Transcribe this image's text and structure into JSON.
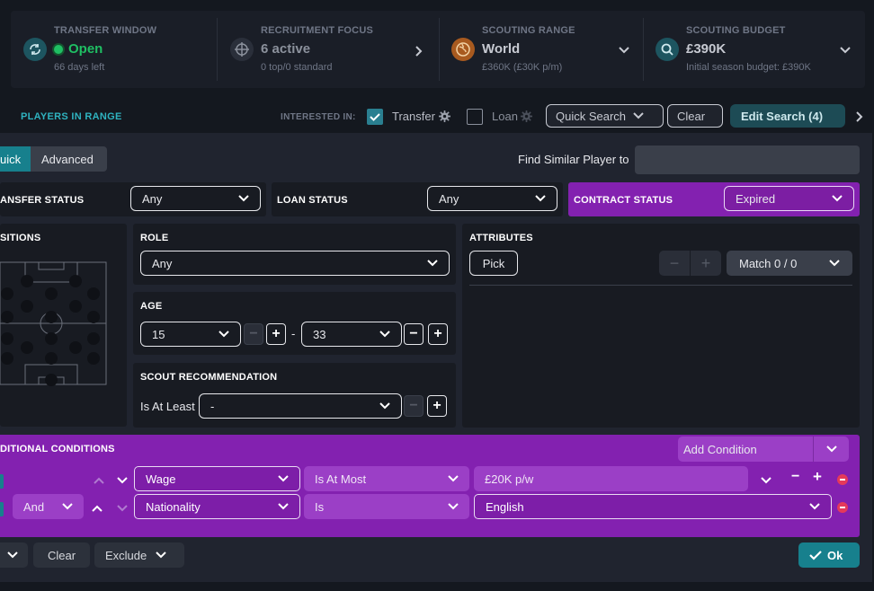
{
  "summary": {
    "transfer_window": {
      "label": "TRANSFER WINDOW",
      "value": "Open",
      "sub": "66 days left"
    },
    "recruitment_focus": {
      "label": "RECRUITMENT FOCUS",
      "value": "6 active",
      "sub": "0 top/0 standard"
    },
    "scouting_range": {
      "label": "SCOUTING RANGE",
      "value": "World",
      "sub": "£360K (£30K p/m)"
    },
    "scouting_budget": {
      "label": "SCOUTING BUDGET",
      "value": "£390K",
      "sub": "Initial season budget: £390K"
    }
  },
  "toolbar": {
    "players_in_range": "PLAYERS IN RANGE",
    "interested_in": "INTERESTED IN:",
    "transfer_label": "Transfer",
    "transfer_checked": true,
    "loan_label": "Loan",
    "loan_checked": false,
    "quick_search": "Quick Search",
    "clear": "Clear",
    "edit_search": "Edit Search (4)"
  },
  "tabs": {
    "quick": "uick",
    "advanced": "Advanced"
  },
  "find_similar": {
    "label": "Find Similar Player to",
    "value": ""
  },
  "status": {
    "transfer_label": "ANSFER STATUS",
    "transfer_value": "Any",
    "loan_label": "LOAN STATUS",
    "loan_value": "Any",
    "contract_label": "CONTRACT STATUS",
    "contract_value": "Expired"
  },
  "positions": {
    "label": "SITIONS"
  },
  "role": {
    "label": "ROLE",
    "value": "Any"
  },
  "age": {
    "label": "AGE",
    "min": "15",
    "sep": "-",
    "max": "33"
  },
  "scout_rec": {
    "label": "SCOUT RECOMMENDATION",
    "prefix": "Is At Least",
    "value": "-"
  },
  "attributes": {
    "label": "ATTRIBUTES",
    "pick": "Pick",
    "match": "Match 0 / 0"
  },
  "conditions": {
    "label": "DITIONAL CONDITIONS",
    "add_condition": "Add Condition",
    "rows": [
      {
        "field": "Wage",
        "operator": "Is At Most",
        "value": "£20K p/w"
      },
      {
        "join": "And",
        "field": "Nationality",
        "operator": "Is",
        "value": "English"
      }
    ]
  },
  "footer": {
    "clear": "Clear",
    "exclude": "Exclude",
    "ok": "Ok"
  },
  "colors": {
    "accent": "#17808d",
    "purple": "#8321b0",
    "open_green": "#1fbf63",
    "background": "#14181f"
  }
}
